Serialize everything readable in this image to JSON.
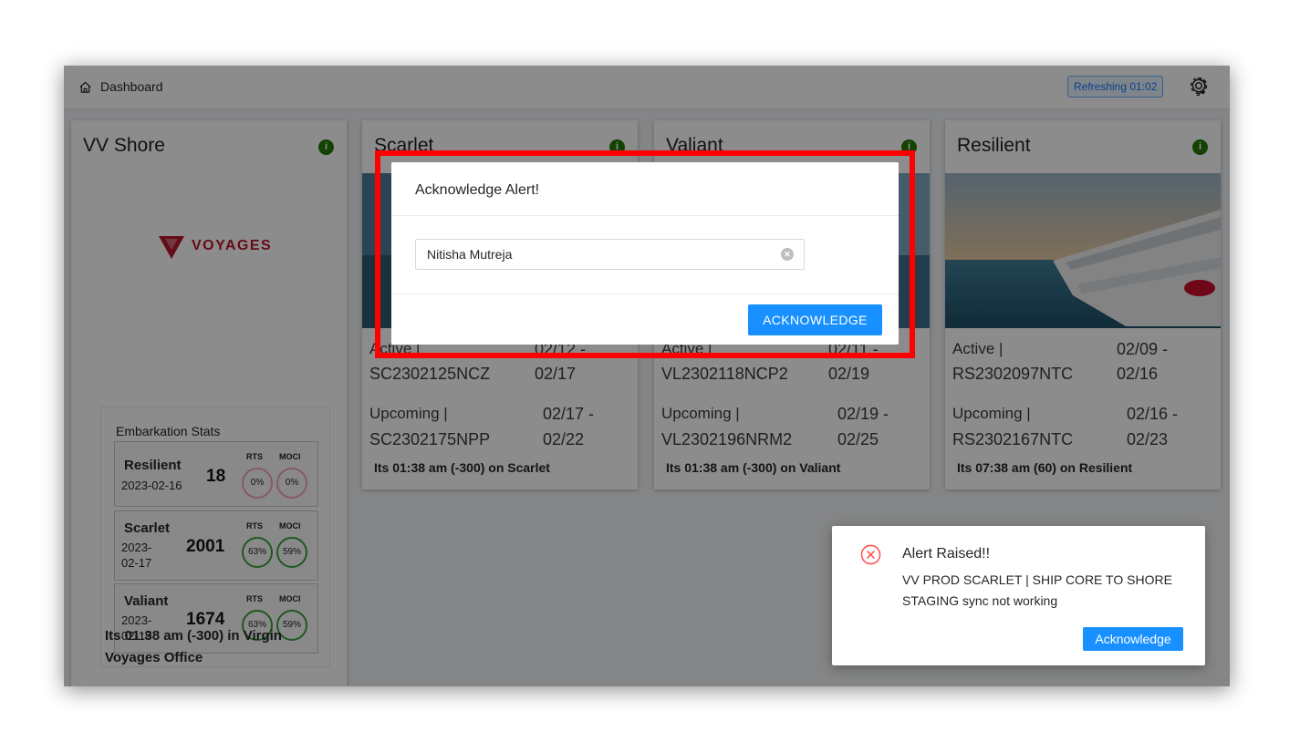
{
  "header": {
    "breadcrumb": "Dashboard",
    "refresh_badge": "Refreshing 01:02"
  },
  "shore_card": {
    "title": "VV Shore",
    "logo_text": "VOYAGES",
    "embarkation": {
      "title": "Embarkation Stats",
      "rts_label": "RTS",
      "moci_label": "MOCI",
      "ships": [
        {
          "name": "Resilient",
          "date": "2023-02-16",
          "count": "18",
          "rts": "0%",
          "moci": "0%",
          "rts_fraction": 0.0,
          "moci_fraction": 0.0
        },
        {
          "name": "Scarlet",
          "date": "2023-\n02-17",
          "count": "2001",
          "rts": "63%",
          "moci": "59%",
          "rts_fraction": 0.63,
          "moci_fraction": 0.59
        },
        {
          "name": "Valiant",
          "date": "2023-\n02-19",
          "count": "1674",
          "rts": "63%",
          "moci": "59%",
          "rts_fraction": 0.63,
          "moci_fraction": 0.59
        }
      ]
    },
    "footer": "Its 01:38 am (-300) in Virgin Voyages Office"
  },
  "ship_cards": [
    {
      "title": "Scarlet",
      "active_label": "Active |",
      "active_code": "SC2302125NCZ",
      "active_range_1": "02/12 -",
      "active_range_2": "02/17",
      "upcoming_label": "Upcoming |",
      "upcoming_code": "SC2302175NPP",
      "upcoming_range_1": "02/17 -",
      "upcoming_range_2": "02/22",
      "local_time": "Its 01:38 am (-300) on Scarlet"
    },
    {
      "title": "Valiant",
      "active_label": "Active |",
      "active_code": "VL2302118NCP2",
      "active_range_1": "02/11 -",
      "active_range_2": "02/19",
      "upcoming_label": "Upcoming |",
      "upcoming_code": "VL2302196NRM2",
      "upcoming_range_1": "02/19 -",
      "upcoming_range_2": "02/25",
      "local_time": "Its 01:38 am (-300) on Valiant"
    },
    {
      "title": "Resilient",
      "active_label": "Active |",
      "active_code": "RS2302097NTC",
      "active_range_1": "02/09 -",
      "active_range_2": "02/16",
      "upcoming_label": "Upcoming |",
      "upcoming_code": "RS2302167NTC",
      "upcoming_range_1": "02/16 -",
      "upcoming_range_2": "02/23",
      "local_time": "Its 07:38 am (60) on Resilient"
    }
  ],
  "modal": {
    "title": "Acknowledge Alert!",
    "input_value": "Nitisha Mutreja",
    "button": "ACKNOWLEDGE"
  },
  "notification": {
    "title": "Alert Raised!!",
    "message": "VV PROD SCARLET | SHIP CORE TO SHORE STAGING sync not working",
    "button": "Acknowledge"
  },
  "colors": {
    "primary": "#1890ff",
    "status_green": "#237804",
    "ring_good": "#3ba13a",
    "ring_low": "#f3a5b4",
    "brand_red": "#b8162e",
    "alert_red": "#ff4d4f",
    "highlight_red": "#ff0000"
  },
  "icons": {
    "home": "home-icon",
    "settings": "gear-icon",
    "status": "info-icon",
    "clear": "clear-icon",
    "alert": "close-circle-icon"
  }
}
